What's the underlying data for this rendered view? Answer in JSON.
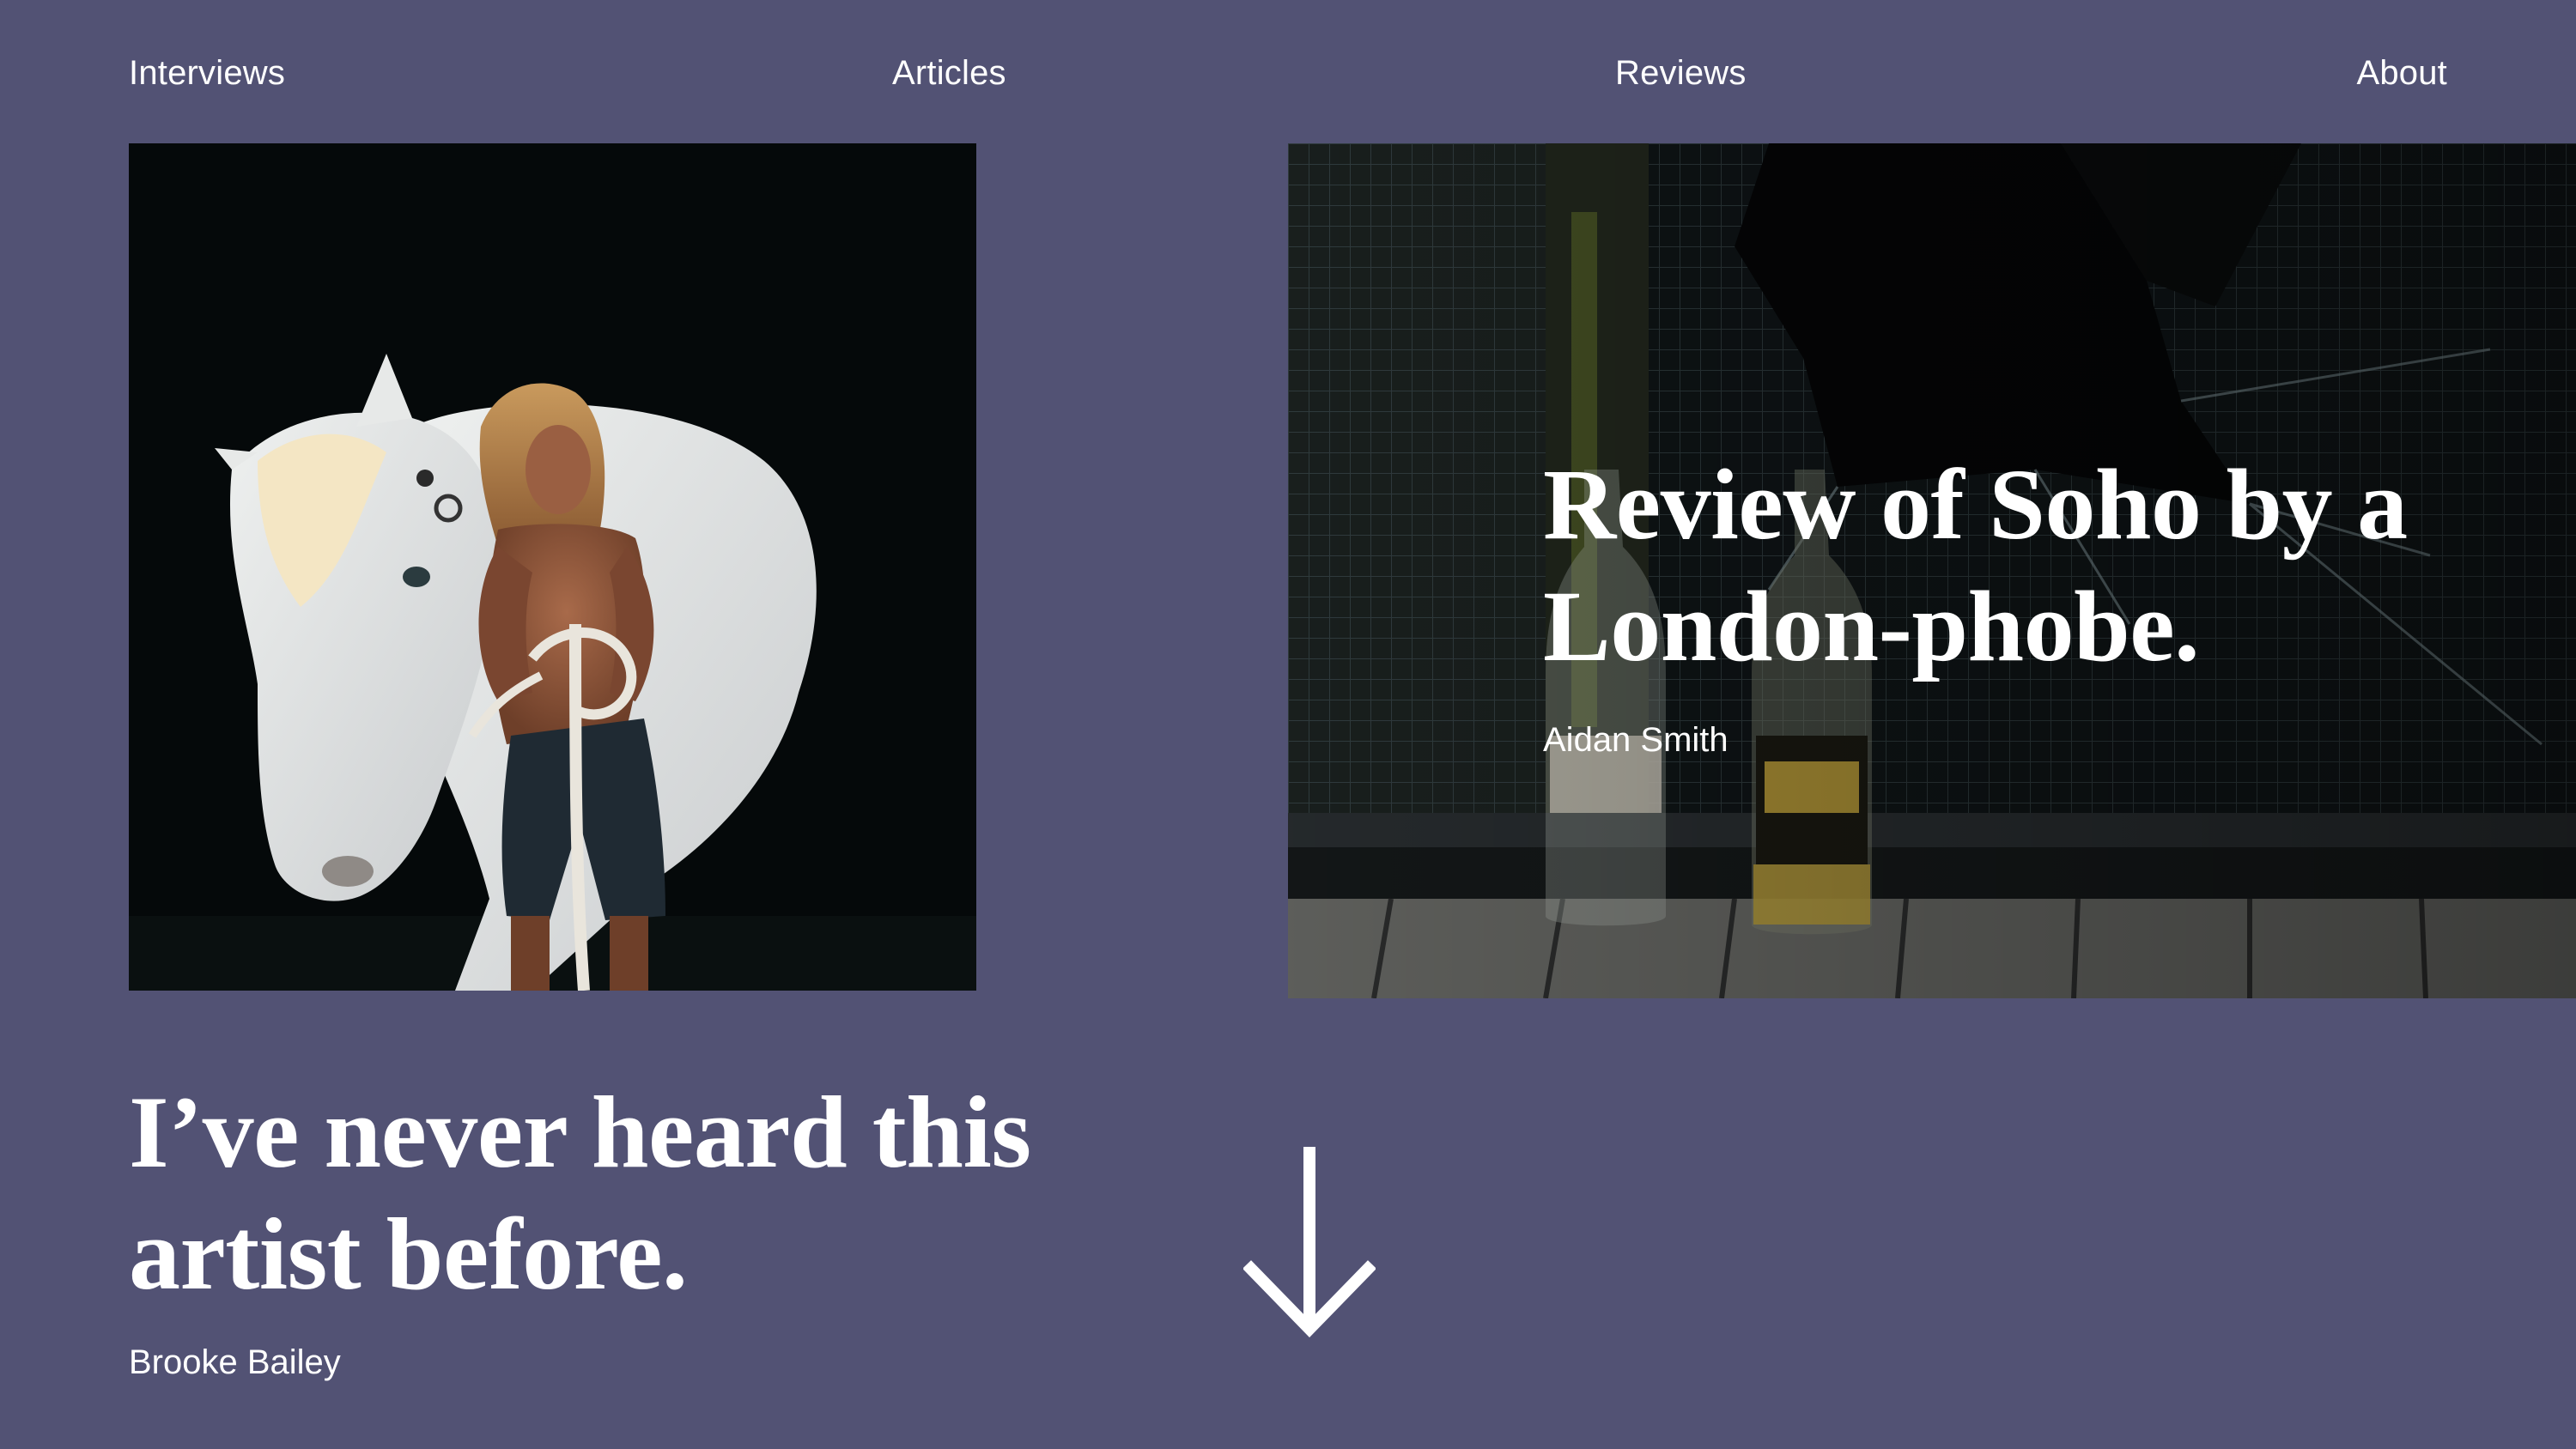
{
  "nav": {
    "items": [
      {
        "label": "Interviews"
      },
      {
        "label": "Articles"
      },
      {
        "label": "Reviews"
      },
      {
        "label": "About"
      }
    ]
  },
  "features": {
    "left": {
      "title": "I’ve never heard this artist before.",
      "author": "Brooke Bailey",
      "image": "photo-woman-with-white-horse"
    },
    "right": {
      "title": "Review of Soho by a London-phobe.",
      "author": "Aidan Smith",
      "image": "photo-bottles-broken-window"
    }
  },
  "scroll": {
    "icon": "arrow-down-icon"
  },
  "colors": {
    "background": "#525274",
    "text": "#ffffff"
  }
}
